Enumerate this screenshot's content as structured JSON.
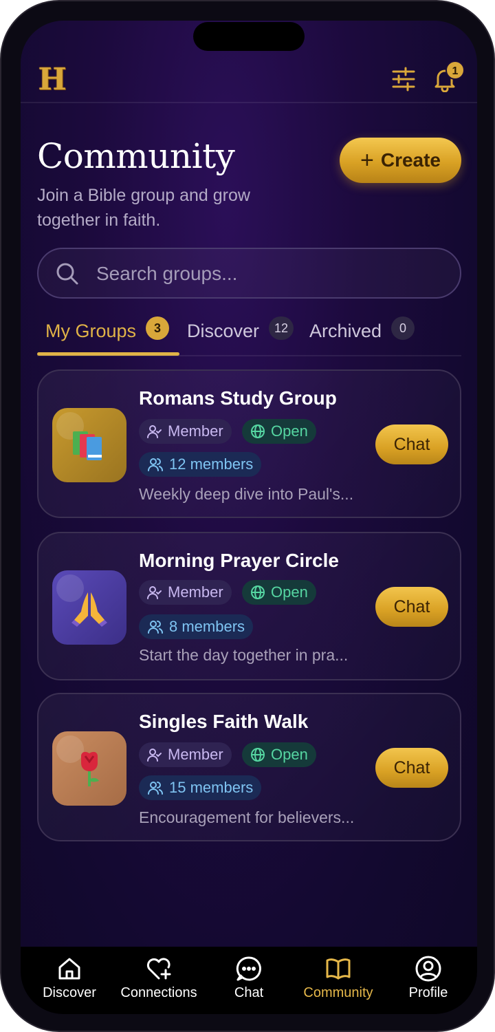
{
  "header": {
    "logo_letter": "H",
    "notification_count": "1"
  },
  "page": {
    "title": "Community",
    "subtitle": "Join a Bible group and grow together in faith.",
    "create_label": "Create"
  },
  "search": {
    "placeholder": "Search groups..."
  },
  "tabs": [
    {
      "label": "My Groups",
      "count": "3",
      "active": true
    },
    {
      "label": "Discover",
      "count": "12",
      "active": false
    },
    {
      "label": "Archived",
      "count": "0",
      "active": false
    }
  ],
  "groups": [
    {
      "name": "Romans Study Group",
      "role": "Member",
      "privacy": "Open",
      "members": "12 members",
      "description": "Weekly deep dive into Paul's...",
      "icon": "books-emoji",
      "icon_bg": "#b08a2a",
      "chat_label": "Chat"
    },
    {
      "name": "Morning Prayer Circle",
      "role": "Member",
      "privacy": "Open",
      "members": "8 members",
      "description": "Start the day together in pra...",
      "icon": "praying-hands-emoji",
      "icon_bg": "#4b3a9a",
      "chat_label": "Chat"
    },
    {
      "name": "Singles Faith Walk",
      "role": "Member",
      "privacy": "Open",
      "members": "15 members",
      "description": "Encouragement for believers...",
      "icon": "rose-emoji",
      "icon_bg": "#b87a52",
      "chat_label": "Chat"
    }
  ],
  "nav": [
    {
      "label": "Discover",
      "icon": "home-icon",
      "active": false
    },
    {
      "label": "Connections",
      "icon": "heart-plus-icon",
      "active": false
    },
    {
      "label": "Chat",
      "icon": "chat-bubble-icon",
      "active": false
    },
    {
      "label": "Community",
      "icon": "book-icon",
      "active": true
    },
    {
      "label": "Profile",
      "icon": "user-circle-icon",
      "active": false
    }
  ],
  "colors": {
    "accent_gold": "#e0b347",
    "background": "#1c0a3d",
    "open_green": "#56d6a2",
    "members_blue": "#7fc4f2"
  }
}
